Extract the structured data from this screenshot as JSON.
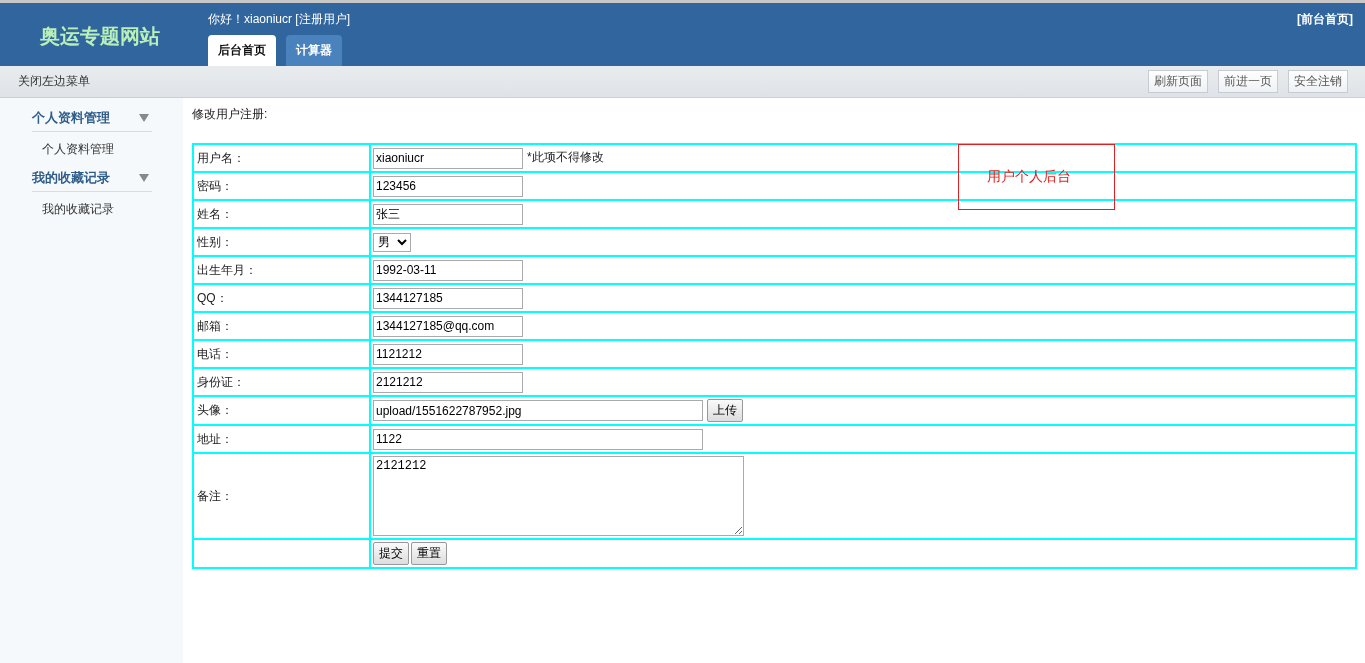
{
  "header": {
    "logo": "奥运专题网站",
    "greeting": "你好！xiaoniucr [注册用户]",
    "front_link": "[前台首页]",
    "tabs": [
      {
        "label": "后台首页",
        "selected": true
      },
      {
        "label": "计算器",
        "selected": false
      }
    ]
  },
  "toolbar": {
    "toggle_menu": "关闭左边菜单",
    "buttons": [
      "刷新页面",
      "前进一页",
      "安全注销"
    ]
  },
  "sidebar": {
    "groups": [
      {
        "title": "个人资料管理",
        "expanded": true,
        "items": [
          "个人资料管理"
        ]
      },
      {
        "title": "我的收藏记录",
        "expanded": true,
        "items": [
          "我的收藏记录"
        ]
      }
    ]
  },
  "form": {
    "title": "修改用户注册:",
    "rows": [
      {
        "label": "用户名：",
        "kind": "text",
        "value": "xiaoniucr",
        "note": "*此项不得修改"
      },
      {
        "label": "密码：",
        "kind": "text",
        "value": "123456"
      },
      {
        "label": "姓名：",
        "kind": "text",
        "value": "张三"
      },
      {
        "label": "性别：",
        "kind": "select",
        "value": "男"
      },
      {
        "label": "出生年月：",
        "kind": "text",
        "value": "1992-03-11"
      },
      {
        "label": "QQ：",
        "kind": "text",
        "value": "1344127185"
      },
      {
        "label": "邮箱：",
        "kind": "text",
        "value": "1344127185@qq.com"
      },
      {
        "label": "电话：",
        "kind": "text",
        "value": "1121212"
      },
      {
        "label": "身份证：",
        "kind": "text",
        "value": "2121212"
      },
      {
        "label": "头像：",
        "kind": "file",
        "value": "upload/1551622787952.jpg",
        "button": "上传"
      },
      {
        "label": "地址：",
        "kind": "wide",
        "value": "1122"
      },
      {
        "label": "备注：",
        "kind": "textarea",
        "value": "2121212"
      },
      {
        "kind": "buttons",
        "buttons": [
          "提交",
          "重置"
        ]
      }
    ]
  },
  "overlay_note": "用户个人后台"
}
